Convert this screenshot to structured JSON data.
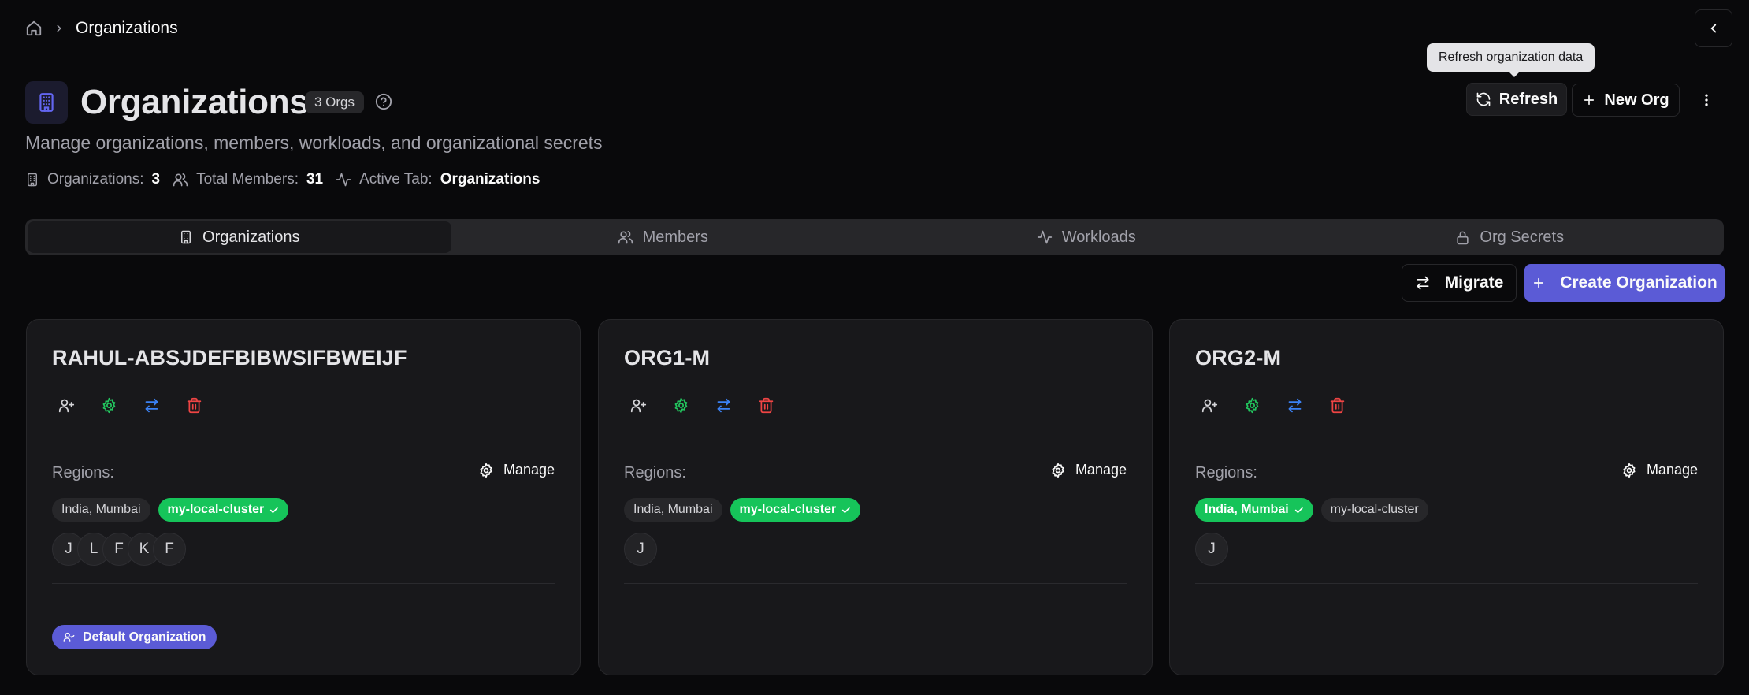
{
  "breadcrumb": {
    "home_icon": "home-icon",
    "separator_icon": "chevron-right-icon",
    "current": "Organizations"
  },
  "header": {
    "title": "Organizations",
    "count_badge": "3 Orgs",
    "subtitle": "Manage organizations, members, workloads, and organizational secrets",
    "stats": [
      {
        "label": "Organizations:",
        "value": "3"
      },
      {
        "label": "Total Members:",
        "value": "31"
      },
      {
        "label": "Active Tab:",
        "value": "Organizations"
      }
    ],
    "tooltip": "Refresh organization data",
    "refresh_label": "Refresh",
    "new_org_label": "New Org"
  },
  "tabs": [
    {
      "label": "Organizations",
      "icon": "building-icon",
      "active": true
    },
    {
      "label": "Members",
      "icon": "users-icon",
      "active": false
    },
    {
      "label": "Workloads",
      "icon": "activity-icon",
      "active": false
    },
    {
      "label": "Org Secrets",
      "icon": "lock-icon",
      "active": false
    }
  ],
  "toolbar": {
    "migrate_label": "Migrate",
    "create_label": "Create Organization"
  },
  "cards": [
    {
      "name": "RAHUL-ABSJDEFBIBWSIFBWEIJF",
      "regions_label": "Regions:",
      "manage_label": "Manage",
      "regions": [
        {
          "label": "India, Mumbai",
          "active": false
        },
        {
          "label": "my-local-cluster",
          "active": true
        }
      ],
      "members": [
        "J",
        "L",
        "F",
        "K",
        "F"
      ],
      "badge": "Default Organization"
    },
    {
      "name": "ORG1-M",
      "regions_label": "Regions:",
      "manage_label": "Manage",
      "regions": [
        {
          "label": "India, Mumbai",
          "active": false
        },
        {
          "label": "my-local-cluster",
          "active": true
        }
      ],
      "members": [
        "J"
      ]
    },
    {
      "name": "ORG2-M",
      "regions_label": "Regions:",
      "manage_label": "Manage",
      "regions": [
        {
          "label": "India, Mumbai",
          "active": true
        },
        {
          "label": "my-local-cluster",
          "active": false
        }
      ],
      "members": [
        "J"
      ]
    }
  ],
  "colors": {
    "accent": "#5b5bd6",
    "success": "#16c45a",
    "danger": "#ef4444",
    "info": "#3b82f6",
    "green_icon": "#22c55e"
  }
}
